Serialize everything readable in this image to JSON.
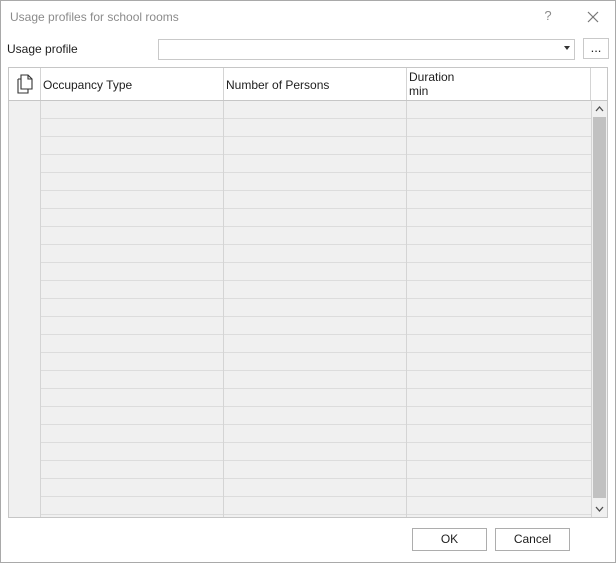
{
  "window": {
    "title": "Usage profiles for school rooms",
    "help_glyph": "?",
    "close_glyph": "✕"
  },
  "profile": {
    "label": "Usage profile",
    "value": "",
    "more_label": "..."
  },
  "grid": {
    "columns": [
      {
        "label": "Occupancy Type",
        "unit": ""
      },
      {
        "label": "Number of Persons",
        "unit": ""
      },
      {
        "label": "Duration",
        "unit": "min"
      }
    ],
    "row_count": 23,
    "copy_icon": "copy-icon"
  },
  "scrollbar": {
    "up_glyph": "▲",
    "down_glyph": "▼"
  },
  "buttons": {
    "ok": "OK",
    "cancel": "Cancel"
  }
}
